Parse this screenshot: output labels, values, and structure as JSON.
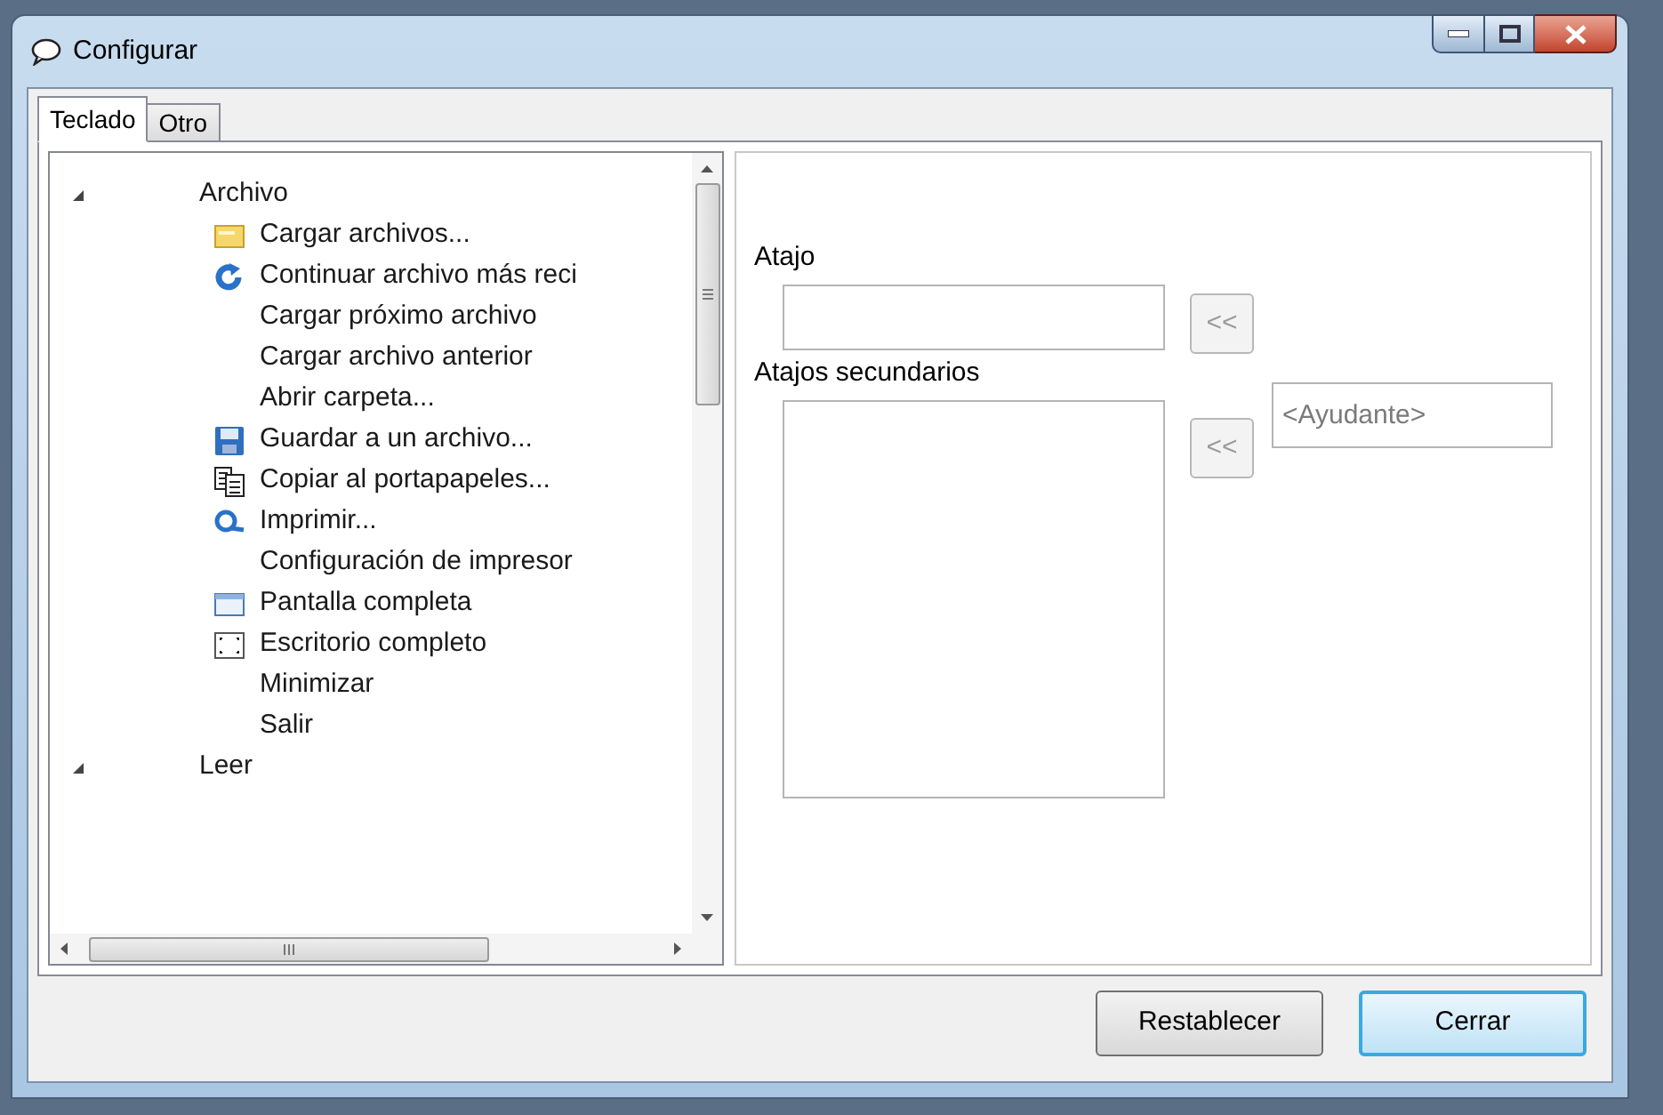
{
  "window": {
    "title": "Configurar"
  },
  "tabs": [
    {
      "label": "Teclado",
      "selected": true
    },
    {
      "label": "Otro",
      "selected": false
    }
  ],
  "tree": [
    {
      "label": "Archivo",
      "expanded": true,
      "children": [
        {
          "label": "Cargar archivos...",
          "kind": "folder"
        },
        {
          "label": "Continuar archivo más reci",
          "kind": "reload"
        },
        {
          "label": "Cargar próximo archivo"
        },
        {
          "label": "Cargar archivo anterior"
        },
        {
          "label": "Abrir carpeta..."
        },
        {
          "label": "Guardar a un archivo...",
          "kind": "save"
        },
        {
          "label": "Copiar al portapapeles...",
          "kind": "copy"
        },
        {
          "label": "Imprimir...",
          "kind": "magnifier"
        },
        {
          "label": "Configuración de impresor"
        },
        {
          "label": "Pantalla completa",
          "kind": "window"
        },
        {
          "label": "Escritorio completo",
          "kind": "corners"
        },
        {
          "label": "Minimizar"
        },
        {
          "label": "Salir"
        }
      ]
    },
    {
      "label": "Leer",
      "expanded": true
    }
  ],
  "shortcut": {
    "label": "Atajo"
  },
  "secondary": {
    "label": "Atajos secundarios"
  },
  "assign_buttons": [
    "<<",
    "<<"
  ],
  "helper": {
    "placeholder": "<Ayudante>"
  },
  "buttons": [
    {
      "label": "Restablecer",
      "default": false
    },
    {
      "label": "Cerrar",
      "default": true
    }
  ]
}
